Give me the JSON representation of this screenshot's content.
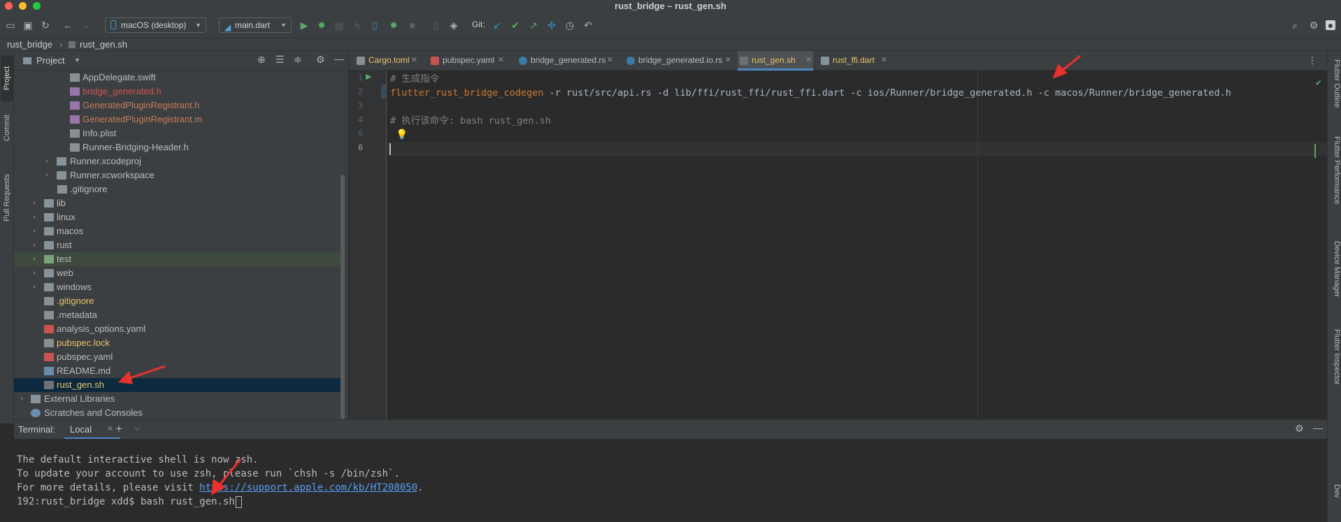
{
  "window": {
    "title": "rust_bridge – rust_gen.sh"
  },
  "toolbar": {
    "device_selector": "macOS (desktop)",
    "run_config": "main.dart",
    "git_label": "Git:"
  },
  "breadcrumb": {
    "project": "rust_bridge",
    "file": "rust_gen.sh"
  },
  "left_stripe": {
    "project": "Project",
    "commit": "Commit",
    "pull_requests": "Pull Requests"
  },
  "right_stripe": {
    "flutter_outline": "Flutter Outline",
    "flutter_performance": "Flutter Performance",
    "device_manager": "Device Manager",
    "flutter_inspector": "Flutter Inspector",
    "device": "Dev"
  },
  "project_panel": {
    "title": "Project",
    "tree": [
      {
        "label": "AppDelegate.swift",
        "color": "#bbbbbb"
      },
      {
        "label": "bridge_generated.h",
        "color": "#d25252"
      },
      {
        "label": "GeneratedPluginRegistrant.h",
        "color": "#c77c5a"
      },
      {
        "label": "GeneratedPluginRegistrant.m",
        "color": "#c77c5a"
      },
      {
        "label": "Info.plist",
        "color": "#bbbbbb"
      },
      {
        "label": "Runner-Bridging-Header.h",
        "color": "#bbbbbb"
      },
      {
        "label": "Runner.xcodeproj",
        "color": "#bbbbbb"
      },
      {
        "label": "Runner.xcworkspace",
        "color": "#bbbbbb"
      },
      {
        "label": ".gitignore",
        "color": "#bbbbbb"
      },
      {
        "label": "lib",
        "color": "#bbbbbb"
      },
      {
        "label": "linux",
        "color": "#bbbbbb"
      },
      {
        "label": "macos",
        "color": "#bbbbbb"
      },
      {
        "label": "rust",
        "color": "#bbbbbb"
      },
      {
        "label": "test",
        "color": "#bbbbbb"
      },
      {
        "label": "web",
        "color": "#bbbbbb"
      },
      {
        "label": "windows",
        "color": "#bbbbbb"
      },
      {
        "label": ".gitignore",
        "color": "#e8c46a"
      },
      {
        "label": ".metadata",
        "color": "#bbbbbb"
      },
      {
        "label": "analysis_options.yaml",
        "color": "#bbbbbb"
      },
      {
        "label": "pubspec.lock",
        "color": "#e8c46a"
      },
      {
        "label": "pubspec.yaml",
        "color": "#bbbbbb"
      },
      {
        "label": "README.md",
        "color": "#bbbbbb"
      },
      {
        "label": "rust_gen.sh",
        "color": "#e8c46a"
      },
      {
        "label": "External Libraries",
        "color": "#bbbbbb"
      },
      {
        "label": "Scratches and Consoles",
        "color": "#bbbbbb"
      }
    ]
  },
  "editor_tabs": [
    {
      "label": "Cargo.toml",
      "color": "#e8c46a"
    },
    {
      "label": "pubspec.yaml",
      "color": "#bbbbbb"
    },
    {
      "label": "bridge_generated.rs",
      "color": "#bbbbbb"
    },
    {
      "label": "bridge_generated.io.rs",
      "color": "#bbbbbb"
    },
    {
      "label": "rust_gen.sh",
      "color": "#e8c46a"
    },
    {
      "label": "rust_ffi.dart",
      "color": "#e8c46a"
    }
  ],
  "editor": {
    "line_numbers": [
      "1",
      "2",
      "3",
      "4",
      "5",
      "6"
    ],
    "line1": "# 生成指令",
    "line2_cmd": "flutter_rust_bridge_codegen",
    "line2_args": " -r rust/src/api.rs -d lib/ffi/rust_ffi/rust_ffi.dart -c ios/Runner/bridge_generated.h -c macos/Runner/bridge_generated.h",
    "line4": "# 执行该命令: bash rust_gen.sh"
  },
  "terminal": {
    "label": "Terminal:",
    "tab": "Local",
    "line1": "The default interactive shell is now zsh.",
    "line2": "To update your account to use zsh, please run `chsh -s /bin/zsh`.",
    "line3_prefix": "For more details, please visit ",
    "line3_link": "https://support.apple.com/kb/HT208050",
    "line3_suffix": ".",
    "prompt": "192:rust_bridge xdd$ bash rust_gen.sh"
  }
}
